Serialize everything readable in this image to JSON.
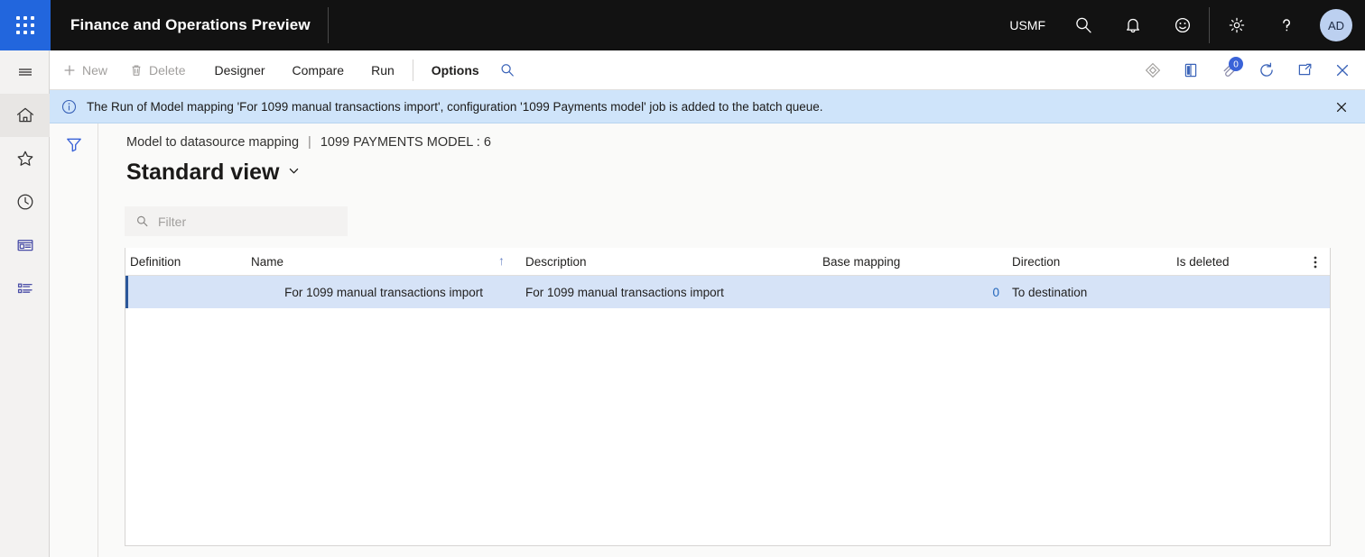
{
  "topbar": {
    "waffle_icon": "app-launcher-icon",
    "app_title": "Finance and Operations Preview",
    "company": "USMF",
    "icons": [
      {
        "name": "search-icon",
        "label": "Search"
      },
      {
        "name": "notifications-bell-icon",
        "label": "Notifications"
      },
      {
        "name": "feedback-smiley-icon",
        "label": "Feedback"
      },
      {
        "name": "settings-gear-icon",
        "label": "Settings"
      },
      {
        "name": "help-question-icon",
        "label": "Help"
      }
    ],
    "avatar_initials": "AD"
  },
  "navrail": {
    "items": [
      {
        "name": "hamburger-menu-icon",
        "label": "Expand the navigation pane",
        "active": false
      },
      {
        "name": "home-icon",
        "label": "Home",
        "active": true
      },
      {
        "name": "favorites-star-icon",
        "label": "Favorites",
        "active": false
      },
      {
        "name": "recent-clock-icon",
        "label": "Recent",
        "active": false
      },
      {
        "name": "workspaces-icon",
        "label": "Workspaces",
        "active": false
      },
      {
        "name": "modules-list-icon",
        "label": "Modules",
        "active": false
      }
    ]
  },
  "toolbar": {
    "new_label": "New",
    "new_enabled": false,
    "delete_label": "Delete",
    "delete_enabled": false,
    "designer_label": "Designer",
    "compare_label": "Compare",
    "run_label": "Run",
    "options_label": "Options",
    "search_icon": "search-icon",
    "right_icons": [
      {
        "name": "personalize-diamond-icon",
        "label": "Personalize"
      },
      {
        "name": "open-in-office-icon",
        "label": "Open in Microsoft Office"
      },
      {
        "name": "attachments-paperclip-icon",
        "label": "Attachments",
        "badge": "0"
      },
      {
        "name": "refresh-icon",
        "label": "Refresh"
      },
      {
        "name": "open-in-new-window-icon",
        "label": "Open in new window"
      },
      {
        "name": "close-icon",
        "label": "Close"
      }
    ]
  },
  "message_bar": {
    "icon": "info-circle-icon",
    "text": "The Run of Model mapping 'For 1099 manual transactions import', configuration '1099 Payments model' job is added to the batch queue.",
    "close_icon": "close-icon",
    "background_color": "#cfe4fa"
  },
  "filter_rail": {
    "filter_icon": "funnel-filter-icon",
    "filter_label": "Show filters"
  },
  "content": {
    "breadcrumb_parent": "Model to datasource mapping",
    "breadcrumb_separator": "|",
    "breadcrumb_current": "1099 PAYMENTS MODEL : 6",
    "page_title": "Standard view",
    "page_title_chevron": "chevron-down-icon"
  },
  "filter_input": {
    "icon": "search-icon",
    "placeholder": "Filter",
    "value": ""
  },
  "grid": {
    "columns": [
      {
        "key": "definition",
        "label": "Definition",
        "align": "left",
        "sorted": false
      },
      {
        "key": "name",
        "label": "Name",
        "align": "right",
        "sorted": true,
        "sort_direction": "ascending",
        "sort_glyph": "↑"
      },
      {
        "key": "description",
        "label": "Description",
        "align": "left",
        "sorted": false
      },
      {
        "key": "base_mapping",
        "label": "Base mapping",
        "align": "right",
        "sorted": false
      },
      {
        "key": "direction",
        "label": "Direction",
        "align": "left",
        "sorted": false
      },
      {
        "key": "is_deleted",
        "label": "Is deleted",
        "align": "left",
        "sorted": false
      }
    ],
    "column_menu_icon": "more-vertical-icon",
    "rows": [
      {
        "selected": true,
        "definition": "",
        "name": "For 1099 manual transactions import",
        "description": "For 1099 manual transactions import",
        "base_mapping": "0",
        "direction": "To destination",
        "is_deleted": ""
      }
    ],
    "selected_row_color": "#d6e3f7",
    "selection_marker_color": "#2b579a"
  }
}
